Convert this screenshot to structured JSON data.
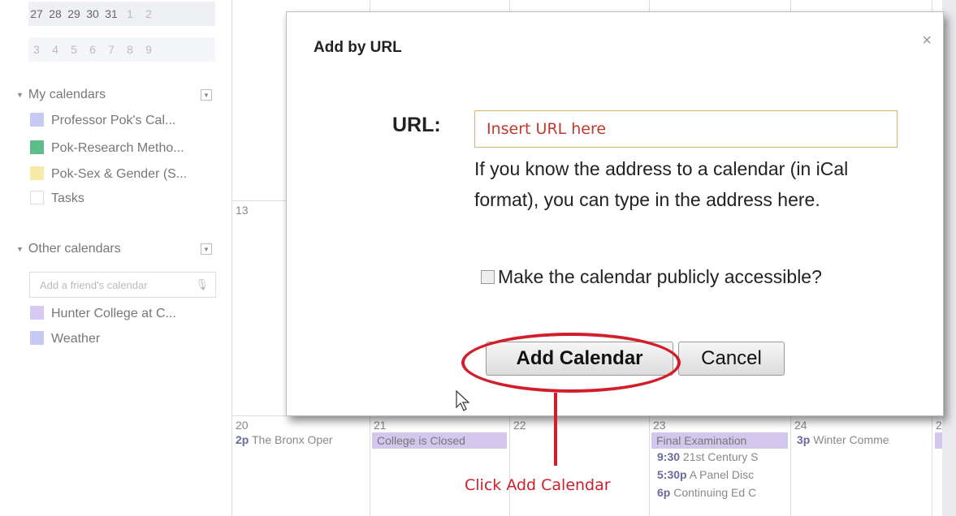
{
  "mini_calendar": {
    "row1": [
      "27",
      "28",
      "29",
      "30",
      "31",
      "1",
      "2"
    ],
    "row2": [
      "3",
      "4",
      "5",
      "6",
      "7",
      "8",
      "9"
    ]
  },
  "my_calendars": {
    "heading": "My calendars",
    "items": [
      {
        "label": "Professor Pok's Cal...",
        "color": "#c6c9f2"
      },
      {
        "label": "Pok-Research Metho...",
        "color": "#5fbd8c"
      },
      {
        "label": "Pok-Sex & Gender (S...",
        "color": "#f6eaa8"
      },
      {
        "label": "Tasks",
        "color": "#ffffff"
      }
    ]
  },
  "other_calendars": {
    "heading": "Other calendars",
    "friend_placeholder": "Add a friend's calendar",
    "items": [
      {
        "label": "Hunter College at C...",
        "color": "#d6c9f2"
      },
      {
        "label": "Weather",
        "color": "#c6c9f2"
      }
    ]
  },
  "grid": {
    "day_13": "13",
    "days": [
      "20",
      "21",
      "22",
      "23",
      "24",
      "2"
    ],
    "events": {
      "d20": {
        "time": "2p",
        "text": "The Bronx Oper"
      },
      "d21_chip": "College is Closed",
      "d23_chip": "Final Examination",
      "d23_a": {
        "time": "9:30",
        "text": "21st Century S"
      },
      "d23_b": {
        "time": "5:30p",
        "text": "A Panel Disc"
      },
      "d23_c": {
        "time": "6p",
        "text": "Continuing Ed C"
      },
      "d24": {
        "time": "3p",
        "text": "Winter Comme"
      }
    }
  },
  "dialog": {
    "title": "Add by URL",
    "close": "×",
    "url_label": "URL:",
    "url_placeholder": "Insert URL here",
    "url_value": "",
    "help_text": "If you know the address to a calendar (in iCal format), you can type in the address here.",
    "public_label": "Make the calendar publicly accessible?",
    "public_checked": false,
    "add_button": "Add Calendar",
    "cancel_button": "Cancel"
  },
  "annotation": {
    "text": "Click Add Calendar",
    "color": "#d11e2a"
  }
}
